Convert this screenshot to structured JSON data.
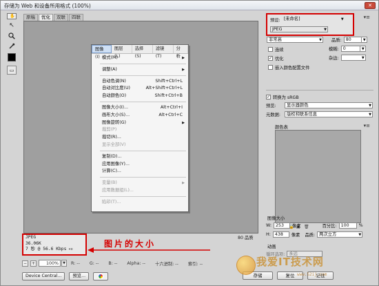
{
  "window": {
    "title": "存储为 Web 和设备所用格式 (100%)",
    "close_label": "✕"
  },
  "tools": [
    {
      "name": "hand-tool-icon",
      "glyph": "✋"
    },
    {
      "name": "slice-select-tool-icon",
      "glyph": "↖"
    },
    {
      "name": "zoom-tool-icon",
      "glyph": "🔍"
    },
    {
      "name": "eyedropper-tool-icon",
      "glyph": "✎"
    }
  ],
  "tabs": [
    "原稿",
    "优化",
    "双联",
    "四联"
  ],
  "ps_menubar": [
    "图像(I)",
    "图层(L)",
    "选择(S)",
    "滤镜(T)",
    "分析"
  ],
  "ps_menu": [
    {
      "label": "模式(M)",
      "sub": true
    },
    {
      "sep": true
    },
    {
      "label": "调整(A)",
      "sub": true
    },
    {
      "sep": true
    },
    {
      "label": "自动色调(N)",
      "shortcut": "Shift+Ctrl+L"
    },
    {
      "label": "自动对比度(U)",
      "shortcut": "Alt+Shift+Ctrl+L"
    },
    {
      "label": "自动颜色(O)",
      "shortcut": "Shift+Ctrl+B"
    },
    {
      "sep": true
    },
    {
      "label": "图像大小(I)...",
      "shortcut": "Alt+Ctrl+I"
    },
    {
      "label": "画布大小(S)...",
      "shortcut": "Alt+Ctrl+C"
    },
    {
      "label": "图像旋转(G)",
      "sub": true
    },
    {
      "label": "裁剪(P)",
      "disabled": true
    },
    {
      "label": "裁切(R)..."
    },
    {
      "label": "显示全部(V)",
      "disabled": true
    },
    {
      "sep": true
    },
    {
      "label": "复制(D)..."
    },
    {
      "label": "应用图像(Y)..."
    },
    {
      "label": "计算(C)..."
    },
    {
      "sep": true
    },
    {
      "label": "变量(B)",
      "sub": true,
      "disabled": true
    },
    {
      "label": "应用数据组(L)...",
      "disabled": true
    },
    {
      "sep": true
    },
    {
      "label": "陷印(T)...",
      "disabled": true
    }
  ],
  "info": {
    "format": "JPEG",
    "size": "36.06K",
    "time": "7 秒 @ 56.6 Kbps",
    "time_menu": "▾≡",
    "quality": "80 品质"
  },
  "annotation": "图片的大小",
  "status": {
    "zoom": "100%",
    "r": "R: --",
    "g": "G: --",
    "b": "B: --",
    "alpha": "Alpha: --",
    "hex": "十六进制: --",
    "index": "索引: --"
  },
  "buttons": {
    "device_central": "Device Central...",
    "preview": "预览...",
    "save": "存储",
    "reset": "复位",
    "remember": "记住"
  },
  "panel": {
    "preset_label": "预设:",
    "preset_value": "[未命名]",
    "format": "JPEG",
    "quality_select": "非常高",
    "quality_label": "品质:",
    "quality_value": "80",
    "progressive": "连续",
    "blur_label": "模糊:",
    "blur_value": "0",
    "optimized": "优化",
    "matte_label": "杂边:",
    "embed_profile": "嵌入颜色配置文件",
    "convert_srgb": "转换为 sRGB",
    "preview_label": "预览:",
    "preview_value": "显示器颜色",
    "metadata_label": "元数据:",
    "metadata_value": "版权和联系信息",
    "color_table_label": "颜色表",
    "image_size_label": "图像大小",
    "w_label": "W:",
    "w_value": "253",
    "h_label": "H:",
    "h_value": "438",
    "px": "像素",
    "percent_label": "百分比:",
    "percent_value": "100",
    "percent_unit": "%",
    "resample_label": "品质:",
    "resample_value": "两次立方",
    "animation_label": "动画",
    "loop_label": "循环选项:",
    "loop_value": "永远"
  },
  "watermark": {
    "text": "我爱IT技术网",
    "sub": "www.52ij.com"
  },
  "colors": {
    "highlight_red": "#d40000",
    "canvas_gray": "#9f9f9f"
  }
}
